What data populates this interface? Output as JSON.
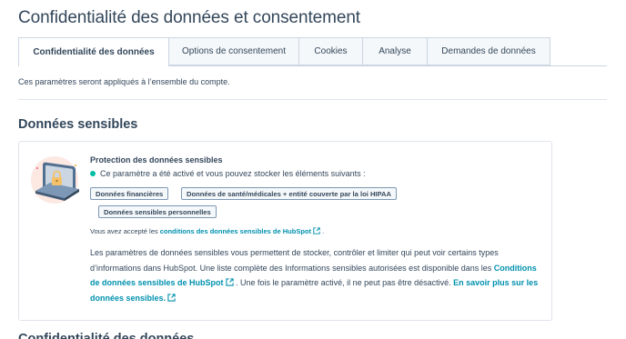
{
  "page": {
    "title": "Confidentialité des données et consentement"
  },
  "tabs": [
    {
      "label": "Confidentialité des données",
      "active": true
    },
    {
      "label": "Options de consentement",
      "active": false
    },
    {
      "label": "Cookies",
      "active": false
    },
    {
      "label": "Analyse",
      "active": false
    },
    {
      "label": "Demandes de données",
      "active": false
    }
  ],
  "intro": "Ces paramètres seront appliqués à l’ensemble du compte.",
  "sensitive": {
    "section_title": "Données sensibles",
    "card_title": "Protection des données sensibles",
    "status_text": "Ce paramètre a été activé et vous pouvez stocker les éléments suivants :",
    "status_color": "#00bda5",
    "tags": [
      "Données financières",
      "Données de santé/médicales + entité couverte par la loi HIPAA",
      "Données sensibles personnelles"
    ],
    "terms_prefix": "Vous avez accepté les ",
    "terms_link": "conditions des données sensibles de HubSpot",
    "terms_suffix": " .",
    "desc_part1": "Les paramètres de données sensibles vous permettent de stocker, contrôler et limiter qui peut voir certains types d’informations dans HubSpot. Une liste complète des Informations sensibles autorisées est disponible dans les ",
    "desc_link1": "Conditions de données sensibles de HubSpot",
    "desc_part2": " . Une fois le paramètre activé, il ne peut pas être désactivé. ",
    "desc_link2": "En savoir plus sur les données sensibles."
  },
  "next_section_title": "Confidentialité des données",
  "colors": {
    "link": "#0091ae",
    "text": "#33475b",
    "border": "#cbd6e2"
  },
  "icons": [
    "external-link-icon",
    "laptop-lock-illustration"
  ]
}
